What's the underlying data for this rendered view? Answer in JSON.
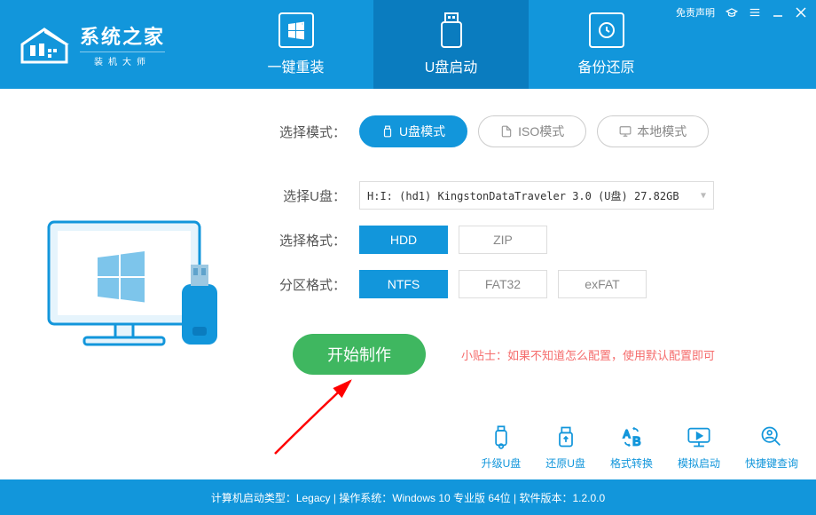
{
  "titlebar": {
    "disclaimer": "免责声明"
  },
  "logo": {
    "title": "系统之家",
    "subtitle": "装机大师"
  },
  "tabs": {
    "reinstall": "一键重装",
    "usb_boot": "U盘启动",
    "backup": "备份还原"
  },
  "modes": {
    "label": "选择模式：",
    "usb": "U盘模式",
    "iso": "ISO模式",
    "local": "本地模式"
  },
  "usb_drive": {
    "label": "选择U盘：",
    "value": "H:I: (hd1) KingstonDataTraveler 3.0 (U盘) 27.82GB"
  },
  "format": {
    "label": "选择格式：",
    "hdd": "HDD",
    "zip": "ZIP"
  },
  "partition": {
    "label": "分区格式：",
    "ntfs": "NTFS",
    "fat32": "FAT32",
    "exfat": "exFAT"
  },
  "start_button": "开始制作",
  "tip": "小贴士：如果不知道怎么配置，使用默认配置即可",
  "tools": {
    "upgrade": "升级U盘",
    "restore": "还原U盘",
    "convert": "格式转换",
    "simulate": "模拟启动",
    "shortcut": "快捷键查询"
  },
  "statusbar": "计算机启动类型：Legacy | 操作系统：Windows 10 专业版 64位 | 软件版本：1.2.0.0"
}
